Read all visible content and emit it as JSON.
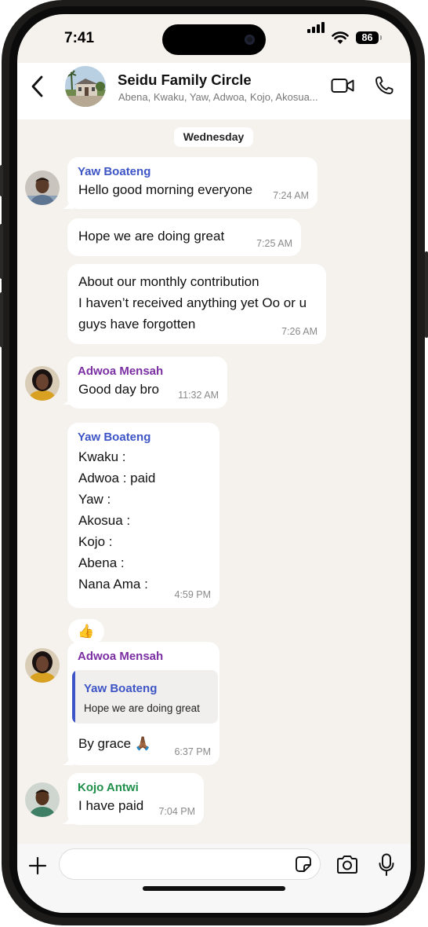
{
  "status": {
    "time": "7:41",
    "battery": "86"
  },
  "header": {
    "title": "Seidu Family Circle",
    "members": "Abena, Kwaku, Yaw, Adwoa, Kojo, Akosua..."
  },
  "day_label": "Wednesday",
  "messages": [
    {
      "sender": "Yaw Boateng",
      "text": "Hello good morning everyone",
      "time": "7:24 AM"
    },
    {
      "text": "Hope we are doing great",
      "time": "7:25 AM"
    },
    {
      "text": "About our monthly contribution\nI haven’t received anything yet Oo or u\nguys have forgotten",
      "time": "7:26 AM"
    },
    {
      "sender": "Adwoa Mensah",
      "text": "Good day bro",
      "time": "11:32 AM"
    },
    {
      "sender": "Yaw Boateng",
      "text": "Kwaku :\nAdwoa : paid\nYaw :\nAkosua :\nKojo :\nAbena :\nNana Ama :",
      "time": "4:59 PM",
      "reaction": "👍"
    },
    {
      "sender": "Adwoa Mensah",
      "quote_sender": "Yaw Boateng",
      "quote_text": "Hope we are doing great",
      "text": "By grace 🙏🏾",
      "time": "6:37 PM"
    },
    {
      "sender": "Kojo Antwi",
      "text": "I have paid",
      "time": "7:04 PM"
    }
  ],
  "composer": {
    "value": "",
    "placeholder": ""
  },
  "colors": {
    "chat_bg": "#f5f2ed",
    "yaw": "#3d55c6",
    "adwoa": "#7b2fa3",
    "kojo": "#1f8f4a",
    "timestamp": "#8a8a8a"
  }
}
